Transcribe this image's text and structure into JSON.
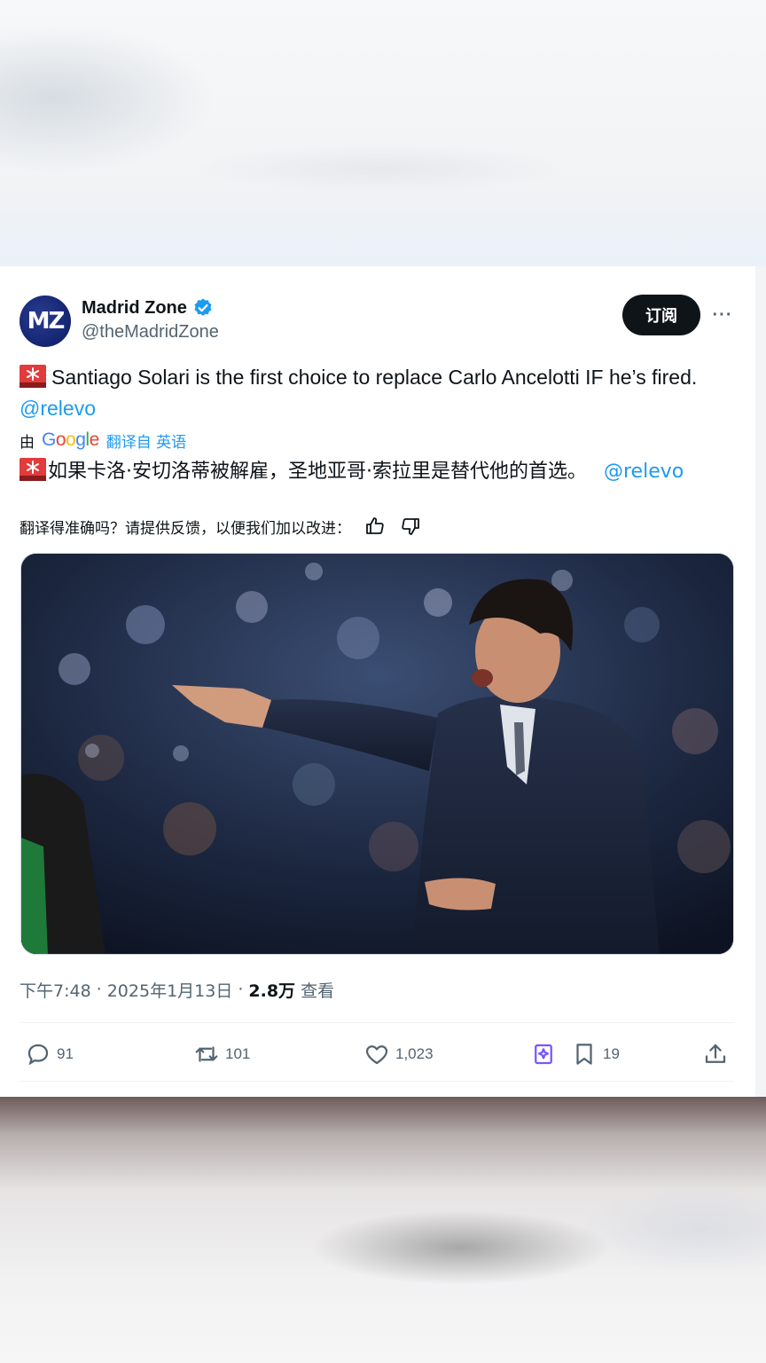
{
  "tweet": {
    "author": {
      "display_name": "Madrid Zone",
      "handle": "@theMadridZone",
      "avatar_text": "MZ",
      "verified": true
    },
    "subscribe_label": "订阅",
    "more_label": "···",
    "text_before_mention": "Santiago Solari is the first choice to replace Carlo Ancelotti IF he’s fired.",
    "mention": "@relevo",
    "translation": {
      "by_label": "由",
      "provider": "Google",
      "translate_from_label": "翻译自 英语",
      "translated_text": "如果卡洛·安切洛蒂被解雇，圣地亚哥·索拉里是替代他的首选。",
      "translated_mention": "@relevo",
      "feedback_prompt": "翻译得准确吗？请提供反馈，以便我们加以改进："
    },
    "time": "下午7:48",
    "date": "2025年1月13日",
    "views_count": "2.8万",
    "views_label": "查看",
    "separator": "·",
    "replies": "91",
    "retweets": "101",
    "likes": "1,023",
    "bookmarks": "19"
  },
  "colors": {
    "text": "#0f1419",
    "secondary": "#536471",
    "link": "#1d9bf0",
    "verified": "#1d9bf0",
    "grok": "#7856ff"
  },
  "icons": {
    "siren": "rotating-light-icon",
    "verified": "verified-badge-icon",
    "thumbs_up": "thumbs-up-icon",
    "thumbs_down": "thumbs-down-icon",
    "reply": "reply-icon",
    "retweet": "retweet-icon",
    "like": "heart-icon",
    "grok": "grok-icon",
    "bookmark": "bookmark-icon",
    "share": "share-icon"
  }
}
